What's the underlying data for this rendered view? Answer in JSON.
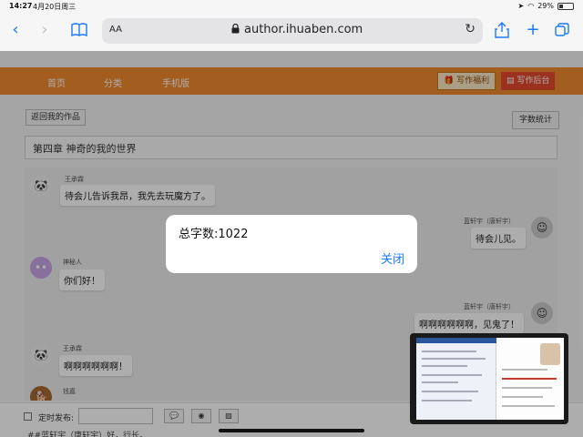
{
  "status_bar": {
    "time": "14:27",
    "date": "4月20日周三",
    "battery": "29%",
    "battery_level": 0.29
  },
  "browser": {
    "reader_label": "AA",
    "url": "author.ihuaben.com"
  },
  "nav": {
    "items": [
      "首页",
      "分类",
      "手机版"
    ],
    "welfare_label": "写作福利",
    "backend_label": "写作后台",
    "accent": "#f08a2e"
  },
  "editor": {
    "back_label": "返回我的作品",
    "count_label": "字数统计",
    "chapter_title": "第四章 神奇的我的世界"
  },
  "messages": [
    {
      "name": "王承霖",
      "text": "待会儿告诉我昂，我先去玩魔方了。",
      "side": "left"
    },
    {
      "name": "蓝轩宇（唐轩宇）",
      "text": "待会儿见。",
      "side": "right"
    },
    {
      "name": "神秘人",
      "text": "你们好！",
      "side": "left"
    },
    {
      "name": "蓝轩宇（唐轩宇）",
      "text": "啊啊啊啊啊啊，见鬼了！",
      "side": "right"
    },
    {
      "name": "王承霖",
      "text": "啊啊啊啊啊啊！",
      "side": "left"
    },
    {
      "name": "钱嘉",
      "text": "",
      "side": "left"
    }
  ],
  "bottom": {
    "schedule_label": "定时发布:",
    "text_preview": "##蓝轩宇（唐轩宇）好，行长。"
  },
  "dialog": {
    "message": "总字数:1022",
    "close_label": "关闭"
  }
}
